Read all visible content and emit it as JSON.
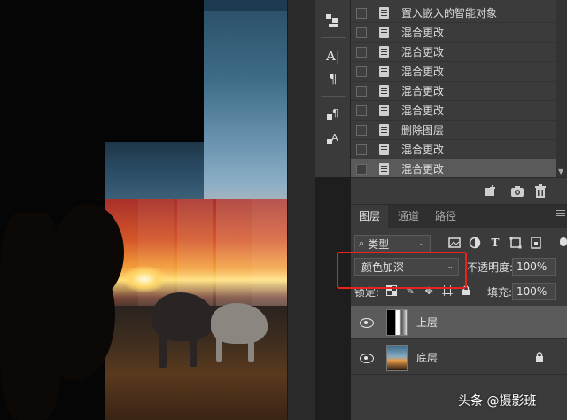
{
  "history": {
    "items": [
      {
        "label": "置入嵌入的智能对象",
        "active": false
      },
      {
        "label": "混合更改",
        "active": false
      },
      {
        "label": "混合更改",
        "active": false
      },
      {
        "label": "混合更改",
        "active": false
      },
      {
        "label": "混合更改",
        "active": false
      },
      {
        "label": "混合更改",
        "active": false
      },
      {
        "label": "删除图层",
        "active": false
      },
      {
        "label": "混合更改",
        "active": false
      },
      {
        "label": "混合更改",
        "active": true
      }
    ],
    "toolbar_icons": [
      "new-document-from-state-icon",
      "new-snapshot-icon",
      "delete-state-icon"
    ]
  },
  "tools": {
    "icons": [
      "clone-source-icon",
      "character-panel-icon",
      "paragraph-panel-icon",
      "paragraph-styles-icon",
      "character-styles-icon"
    ]
  },
  "layers_panel": {
    "tabs": [
      {
        "label": "图层",
        "active": true
      },
      {
        "label": "通道",
        "active": false
      },
      {
        "label": "路径",
        "active": false
      }
    ],
    "filter": {
      "label": "类型"
    },
    "blend_mode": "颜色加深",
    "opacity_label": "不透明度:",
    "opacity_value": "100%",
    "lock_label": "锁定:",
    "fill_label": "填充:",
    "fill_value": "100%",
    "layers": [
      {
        "name": "上层",
        "selected": true,
        "visible": true,
        "locked": false
      },
      {
        "name": "底层",
        "selected": false,
        "visible": true,
        "locked": true
      }
    ]
  },
  "watermark": "头条 @摄影班",
  "colors": {
    "highlight": "#e8231b",
    "panel_bg": "#3b3b3b",
    "selected_row": "#5b5b5b"
  }
}
